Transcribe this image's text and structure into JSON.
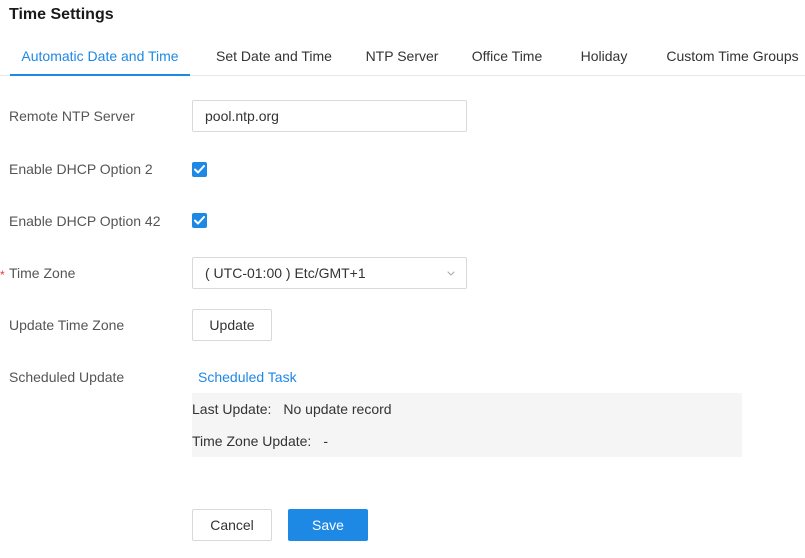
{
  "page": {
    "title": "Time Settings"
  },
  "tabs": [
    {
      "label": "Automatic Date and Time",
      "active": true
    },
    {
      "label": "Set Date and Time",
      "active": false
    },
    {
      "label": "NTP Server",
      "active": false
    },
    {
      "label": "Office Time",
      "active": false
    },
    {
      "label": "Holiday",
      "active": false
    },
    {
      "label": "Custom Time Groups",
      "active": false
    }
  ],
  "form": {
    "remote_ntp_server": {
      "label": "Remote NTP Server",
      "value": "pool.ntp.org"
    },
    "dhcp_option_2": {
      "label": "Enable DHCP Option 2",
      "checked": true
    },
    "dhcp_option_42": {
      "label": "Enable DHCP Option 42",
      "checked": true
    },
    "time_zone": {
      "label": "Time Zone",
      "required_mark": "*",
      "value": "( UTC-01:00 ) Etc/GMT+1"
    },
    "update_time_zone": {
      "label": "Update Time Zone",
      "button_label": "Update"
    },
    "scheduled_update": {
      "label": "Scheduled Update",
      "link_label": "Scheduled Task",
      "last_update_key": "Last Update:",
      "last_update_value": "No update record",
      "tz_update_key": "Time Zone Update:",
      "tz_update_value": "-"
    }
  },
  "actions": {
    "cancel_label": "Cancel",
    "save_label": "Save"
  },
  "colors": {
    "accent": "#1e88e5",
    "required": "#e53935",
    "info_bg": "#f5f5f5"
  },
  "icons": {
    "checkbox": "check-icon",
    "select_arrow": "chevron-down-icon"
  }
}
